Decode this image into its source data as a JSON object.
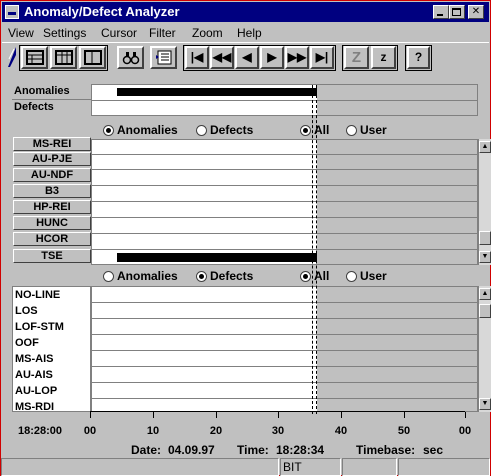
{
  "window": {
    "title": "Anomaly/Defect Analyzer"
  },
  "menu": [
    "View",
    "Settings",
    "Cursor",
    "Filter",
    "Zoom",
    "Help"
  ],
  "toolbar": {
    "z_label": "z",
    "help_label": "?"
  },
  "summary": {
    "labels": [
      "Anomalies",
      "Defects"
    ]
  },
  "anomaly_panel": {
    "radios": [
      "Anomalies",
      "Defects",
      "All",
      "User"
    ],
    "selected": [
      "Anomalies",
      "All"
    ],
    "rows": [
      "MS-REI",
      "AU-PJE",
      "AU-NDF",
      "B3",
      "HP-REI",
      "HUNC",
      "HCOR",
      "TSE"
    ]
  },
  "defect_panel": {
    "radios": [
      "Anomalies",
      "Defects",
      "All",
      "User"
    ],
    "selected": [
      "Defects",
      "All"
    ],
    "rows": [
      "NO-LINE",
      "LOS",
      "LOF-STM",
      "OOF",
      "MS-AIS",
      "AU-AIS",
      "AU-LOP",
      "MS-RDI"
    ]
  },
  "axis": {
    "start_time": "18:28:00",
    "ticks": [
      "00",
      "10",
      "20",
      "30",
      "40",
      "50",
      "00"
    ]
  },
  "info": {
    "date_label": "Date:",
    "date": "04.09.97",
    "time_label": "Time:",
    "time": "18:28:34",
    "timebase_label": "Timebase:",
    "timebase": "sec"
  },
  "status": {
    "mode": "BIT"
  }
}
